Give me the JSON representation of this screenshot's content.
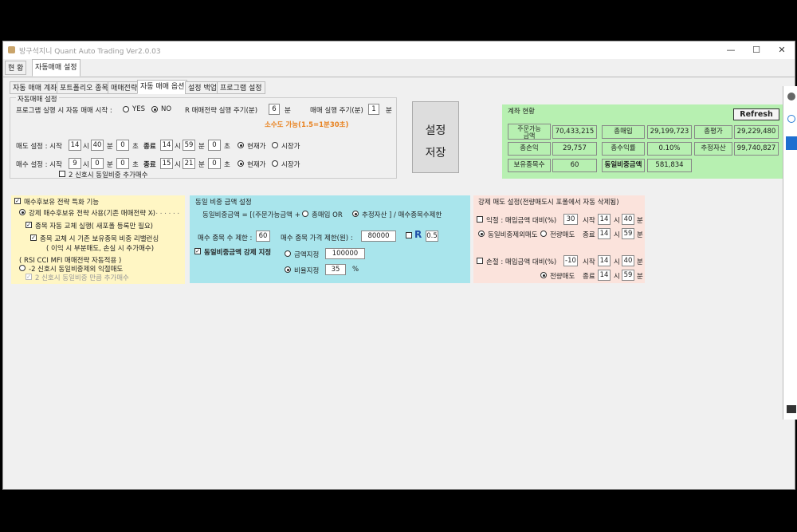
{
  "window": {
    "title": "방구석지니 Quant Auto Trading Ver2.0.03",
    "controls": {
      "minimize": "—",
      "maximize": "☐",
      "close": "✕"
    }
  },
  "top_tabs": [
    "현 황",
    "자동매매 설정"
  ],
  "sub_tabs": [
    "자동 매매 계좌",
    "포트폴리오 종목",
    "매매전략",
    "자동 매매 옵션",
    "설정 백업",
    "프로그램 설정"
  ],
  "auto_trade": {
    "group_title": "자동매매 설정",
    "program_run_label": "프로그램 실행 시 자동 매매 시작 :",
    "yes": "YES",
    "no": "NO",
    "r_period_label": "R 매매전략 실행 주기(분)",
    "r_period_value": "6",
    "r_period_unit": "분",
    "trade_period_label": "매매 실행 주기(분)",
    "trade_period_value": "1",
    "trade_period_unit": "분",
    "decimal_note": "소수도 가능(1.5=1분30초)",
    "sell_label": "매도 설정 : 시작",
    "sell_start_h": "14",
    "sell_start_m": "40",
    "sell_start_s": "0",
    "sell_end_h": "14",
    "sell_end_m": "59",
    "sell_end_s": "0",
    "buy_label": "매수 설정 : 시작",
    "buy_start_h": "9",
    "buy_start_m": "0",
    "buy_start_s": "0",
    "buy_end_h": "15",
    "buy_end_m": "21",
    "buy_end_s": "0",
    "unit_h": "시",
    "unit_m": "분",
    "unit_s": "초",
    "end_label": "종료",
    "current_price": "현재가",
    "market_price": "시장가",
    "second_signal_buy": "2 신호시 동일비중 추가매수",
    "save_button_line1": "설정",
    "save_button_line2": "저장"
  },
  "account": {
    "title": "계좌 현황",
    "refresh": "Refresh",
    "rows": [
      [
        {
          "k": "주문가능\n금액",
          "v": "70,433,215"
        },
        {
          "k": "총매입",
          "v": "29,199,723"
        },
        {
          "k": "총평가",
          "v": "29,229,480"
        }
      ],
      [
        {
          "k": "총손익",
          "v": "29,757"
        },
        {
          "k": "총수익률",
          "v": "0.10%"
        },
        {
          "k": "추정자산",
          "v": "99,740,827"
        }
      ],
      [
        {
          "k": "보유종목수",
          "v": "60"
        },
        {
          "k": "동일비중금액",
          "v": "581,834"
        }
      ]
    ]
  },
  "strategy": {
    "title": "매수후보유 전략 특화 기능",
    "opt1": "강제 매수후보유 전략 사용(기존 매매전략 X)",
    "opt1_dots": ". . . . . . .",
    "opt2": "종목 자동 교체 실행( 새포폴 등록만 필요)",
    "opt3": "종목 교체 시 기존 보유종목 비중 리밸런싱",
    "opt3_sub": "( 이익 시 부분매도, 손실 시 추가매수)",
    "rsi_note": "( RSI CCI MFI 매매전략 자동적용 )",
    "opt4": "-2 신호시 동일비중제외 익절매도",
    "opt5": "2 신호시 동일비중 만큼 추가매수"
  },
  "weight": {
    "title": "동일 비중 금액 설정",
    "formula_a": "동일비중금액 = [(주문가능금액 +",
    "formula_b": "총매입 OR",
    "formula_c": "추정자산 ] / 매수종목수제한",
    "buy_limit_label": "매수 종목 수 제한 :",
    "buy_limit_value": "60",
    "price_limit_label": "매수 종목 가격 제한(원) :",
    "price_limit_value": "80000",
    "r_label": "R",
    "r_value": "0.5",
    "force_label": "동일비중금액 강제 지정",
    "amount_label": "금액지정",
    "amount_value": "100000",
    "ratio_label": "비율지정",
    "ratio_value": "35",
    "ratio_unit": "%"
  },
  "forced_sell": {
    "title": "강제 매도 설정(전량매도시 포폴에서 자동 삭제됨)",
    "profit_label": "익절 : 매입금액 대비(%)",
    "profit_value": "30",
    "profit_start_label": "시작",
    "profit_start_h": "14",
    "profit_start_m": "40",
    "profit_opt1": "동일비중제외매도",
    "profit_opt2": "전량매도",
    "profit_end_label": "종료",
    "profit_end_h": "14",
    "profit_end_m": "59",
    "loss_label": "손절 : 매입금액 대비(%)",
    "loss_value": "-10",
    "loss_start_label": "시작",
    "loss_start_h": "14",
    "loss_start_m": "40",
    "loss_opt": "전량매도",
    "loss_end_label": "종료",
    "loss_end_h": "14",
    "loss_end_m": "59",
    "unit_h": "시",
    "unit_m": "분"
  },
  "colors": {
    "account_bg": "#b7f0b1",
    "strategy_bg": "#fff6c4",
    "weight_bg": "#a9e5ec",
    "sell_bg": "#fbe3dc",
    "note_orange": "#e8811e"
  }
}
